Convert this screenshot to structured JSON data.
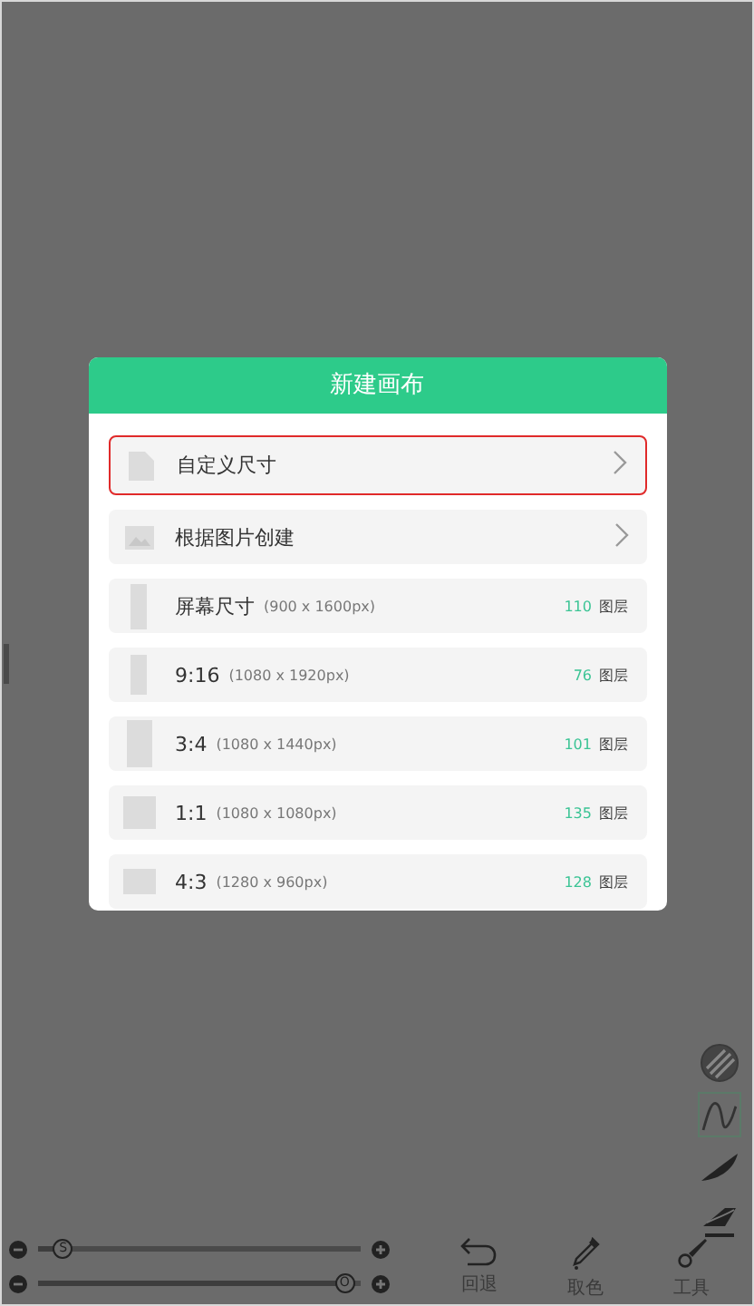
{
  "dialog": {
    "title": "新建画布",
    "options": [
      {
        "kind": "nav",
        "label": "自定义尺寸",
        "selected": true
      },
      {
        "kind": "nav",
        "label": "根据图片创建",
        "selected": false
      },
      {
        "kind": "preset",
        "label": "屏幕尺寸",
        "size": "(900 x 1600px)",
        "count": "110",
        "unit": "图层",
        "selected": false
      },
      {
        "kind": "preset",
        "label": "9:16",
        "size": "(1080 x 1920px)",
        "count": "76",
        "unit": "图层",
        "selected": false
      },
      {
        "kind": "preset",
        "label": "3:4",
        "size": "(1080 x 1440px)",
        "count": "101",
        "unit": "图层",
        "selected": false
      },
      {
        "kind": "preset",
        "label": "1:1",
        "size": "(1080 x 1080px)",
        "count": "135",
        "unit": "图层",
        "selected": false
      },
      {
        "kind": "preset",
        "label": "4:3",
        "size": "(1280 x 960px)",
        "count": "128",
        "unit": "图层",
        "selected": false
      }
    ]
  },
  "side_tools": [
    {
      "kind": "texture",
      "selected": false
    },
    {
      "kind": "curve",
      "selected": true
    },
    {
      "kind": "brush",
      "selected": false
    },
    {
      "kind": "eraser",
      "selected": false
    }
  ],
  "sliders": [
    {
      "thumb": "S",
      "level": 0.05
    },
    {
      "thumb": "O",
      "level": 0.98
    }
  ],
  "toolbar": [
    {
      "kind": "undo",
      "label": "回退"
    },
    {
      "kind": "picker",
      "label": "取色"
    },
    {
      "kind": "tools",
      "label": "工具"
    }
  ]
}
